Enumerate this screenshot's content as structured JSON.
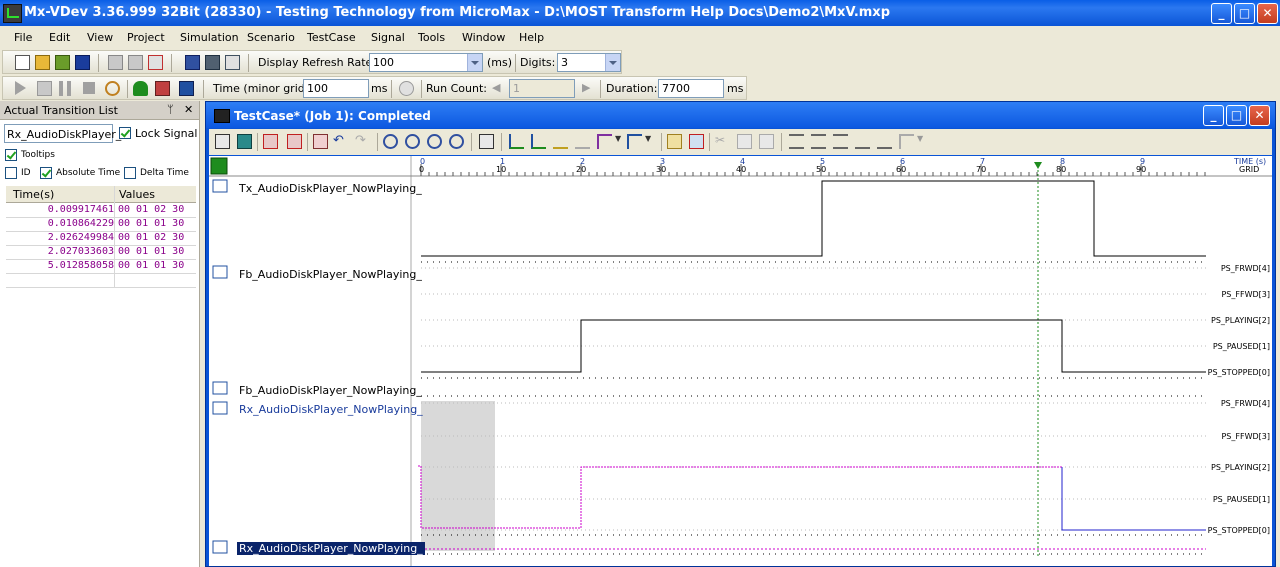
{
  "window": {
    "title": "Mx-VDev 3.36.999 32Bit (28330) - Testing Technology from MicroMax - D:\\MOST Transform Help Docs\\Demo2\\MxV.mxp",
    "minimize": "_",
    "maximize": "□",
    "close": "✕"
  },
  "menubar": {
    "items": [
      "File",
      "Edit",
      "View",
      "Project",
      "Simulation",
      "Scenario",
      "TestCase",
      "Signal",
      "Tools",
      "Window",
      "Help"
    ]
  },
  "toolbar1": {
    "refresh_label": "Display Refresh Rate:",
    "refresh_value": "100",
    "refresh_unit": "(ms)",
    "digits_label": "Digits:",
    "digits_value": "3"
  },
  "toolbar2": {
    "time_label": "Time (minor grid):",
    "time_value": "100",
    "time_unit": "ms",
    "runcount_label": "Run Count:",
    "runcount_value": "1",
    "duration_label": "Duration:",
    "duration_value": "7700",
    "duration_unit": "ms"
  },
  "transition_panel": {
    "title": "Actual Transition List",
    "pin": "ᛘ",
    "close": "✕",
    "signal_name": "Rx_AudioDiskPlayer_I",
    "lock_signal": "Lock Signal",
    "tooltips": "Tooltips",
    "id": "ID",
    "absolute_time": "Absolute Time",
    "delta_time": "Delta Time",
    "columns": [
      "Time(s)",
      "Values"
    ],
    "rows": [
      {
        "time": "0.009917461",
        "value": "00 01 02 30"
      },
      {
        "time": "0.010864229",
        "value": "00 01 01 30"
      },
      {
        "time": "2.026249984",
        "value": "00 01 02 30"
      },
      {
        "time": "2.027033603",
        "value": "00 01 01 30"
      },
      {
        "time": "5.012858058",
        "value": "00 01 01 30"
      }
    ]
  },
  "testcase_window": {
    "title": "TestCase* (Job 1): Completed",
    "axis_major": [
      "0",
      "1",
      "2",
      "3",
      "4",
      "5",
      "6",
      "7",
      "8",
      "9"
    ],
    "axis_minor": [
      "0",
      "10",
      "20",
      "30",
      "40",
      "50",
      "60",
      "70",
      "80",
      "90"
    ],
    "axis_unit_top": "TIME (s)",
    "axis_unit_bottom": "GRID",
    "signals": [
      {
        "name": "Tx_AudioDiskPlayer_NowPlaying_"
      },
      {
        "name": "Fb_AudioDiskPlayer_NowPlaying_",
        "states": [
          "PS_FRWD[4]",
          "PS_FFWD[3]",
          "PS_PLAYING[2]",
          "PS_PAUSED[1]",
          "PS_STOPPED[0]"
        ]
      },
      {
        "name": "Fb_AudioDiskPlayer_NowPlaying_"
      },
      {
        "name": "Rx_AudioDiskPlayer_NowPlaying_",
        "states": [
          "PS_FRWD[4]",
          "PS_FFWD[3]",
          "PS_PLAYING[2]",
          "PS_PAUSED[1]",
          "PS_STOPPED[0]"
        ]
      },
      {
        "name": "Rx_AudioDiskPlayer_NowPlaying_"
      }
    ]
  },
  "colors": {
    "titlebar": "#0a54d6",
    "cursor": "#1e8c1e",
    "rx_trace": "#cc00cc",
    "rx_trace2": "#2222cc",
    "selection": "#0a246a"
  }
}
